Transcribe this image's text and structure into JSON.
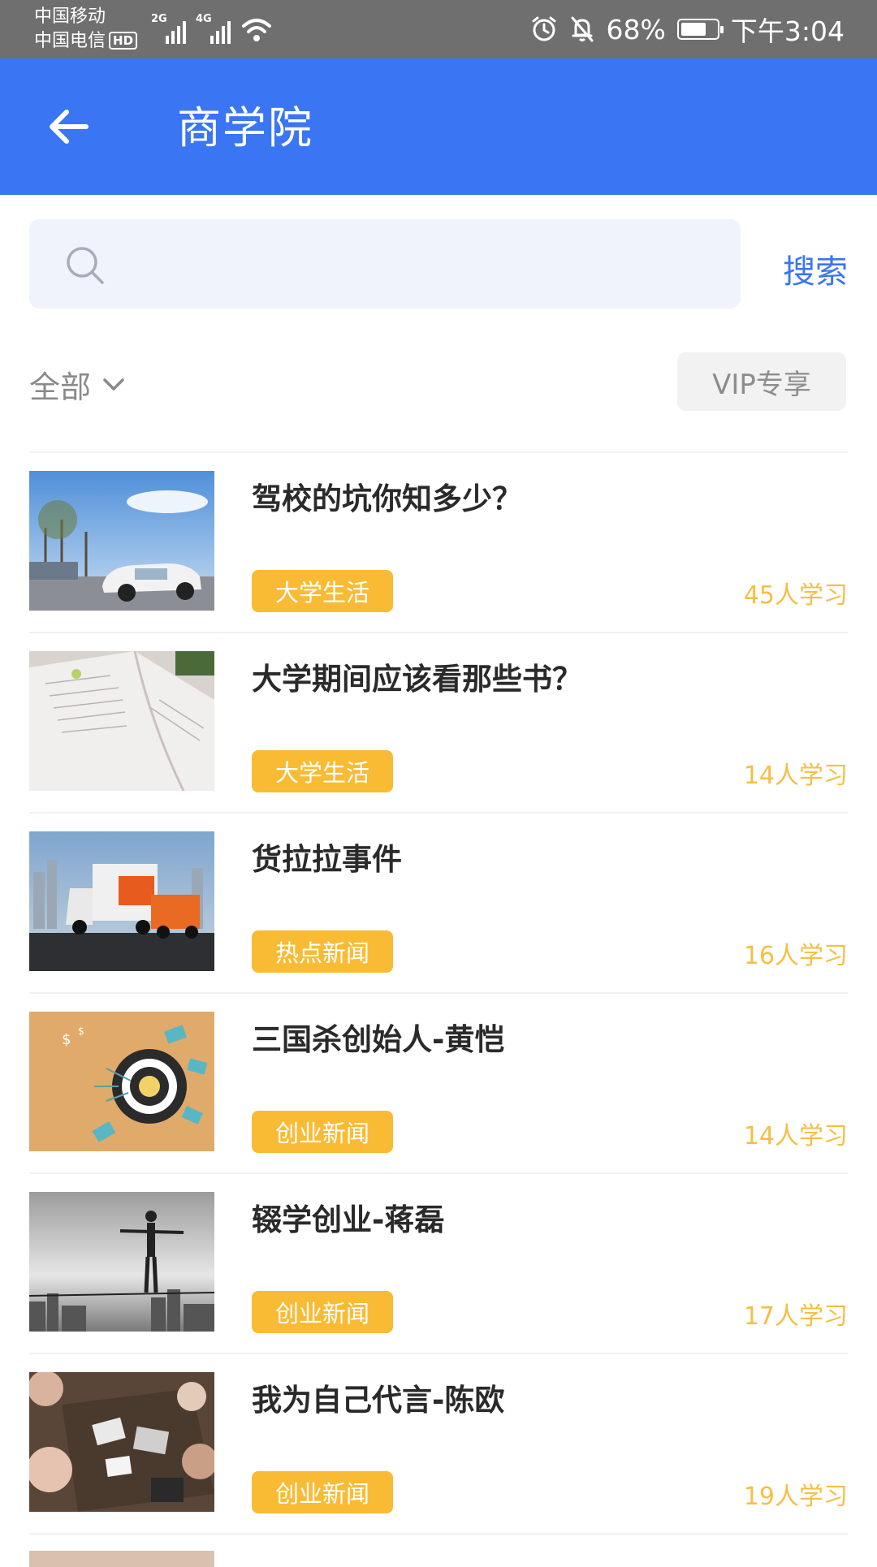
{
  "status_bar": {
    "carrier_1": "中国移动",
    "carrier_2": "中国电信",
    "hd": "HD",
    "net_1": "2G",
    "net_2": "4G",
    "battery": "68%",
    "time": "下午3:04"
  },
  "header": {
    "title": "商学院"
  },
  "search": {
    "placeholder": "",
    "button_label": "搜索"
  },
  "filter": {
    "category_label": "全部",
    "vip_label": "VIP专享"
  },
  "courses": [
    {
      "title": "驾校的坑你知多少？",
      "tag": "大学生活",
      "learners": "45人学习",
      "thumb_icon": "driving-school-car-image"
    },
    {
      "title": "大学期间应该看那些书？",
      "tag": "大学生活",
      "learners": "14人学习",
      "thumb_icon": "open-book-image"
    },
    {
      "title": "货拉拉事件",
      "tag": "热点新闻",
      "learners": "16人学习",
      "thumb_icon": "delivery-trucks-image"
    },
    {
      "title": "三国杀创始人-黄恺",
      "tag": "创业新闻",
      "learners": "14人学习",
      "thumb_icon": "target-money-image"
    },
    {
      "title": "辍学创业-蒋磊",
      "tag": "创业新闻",
      "learners": "17人学习",
      "thumb_icon": "tightrope-businessman-image"
    },
    {
      "title": "我为自己代言-陈欧",
      "tag": "创业新闻",
      "learners": "19人学习",
      "thumb_icon": "team-meeting-image"
    }
  ],
  "colors": {
    "accent": "#3a75f3",
    "tag_bg": "#f9bb34",
    "count_text": "#f6be44"
  }
}
